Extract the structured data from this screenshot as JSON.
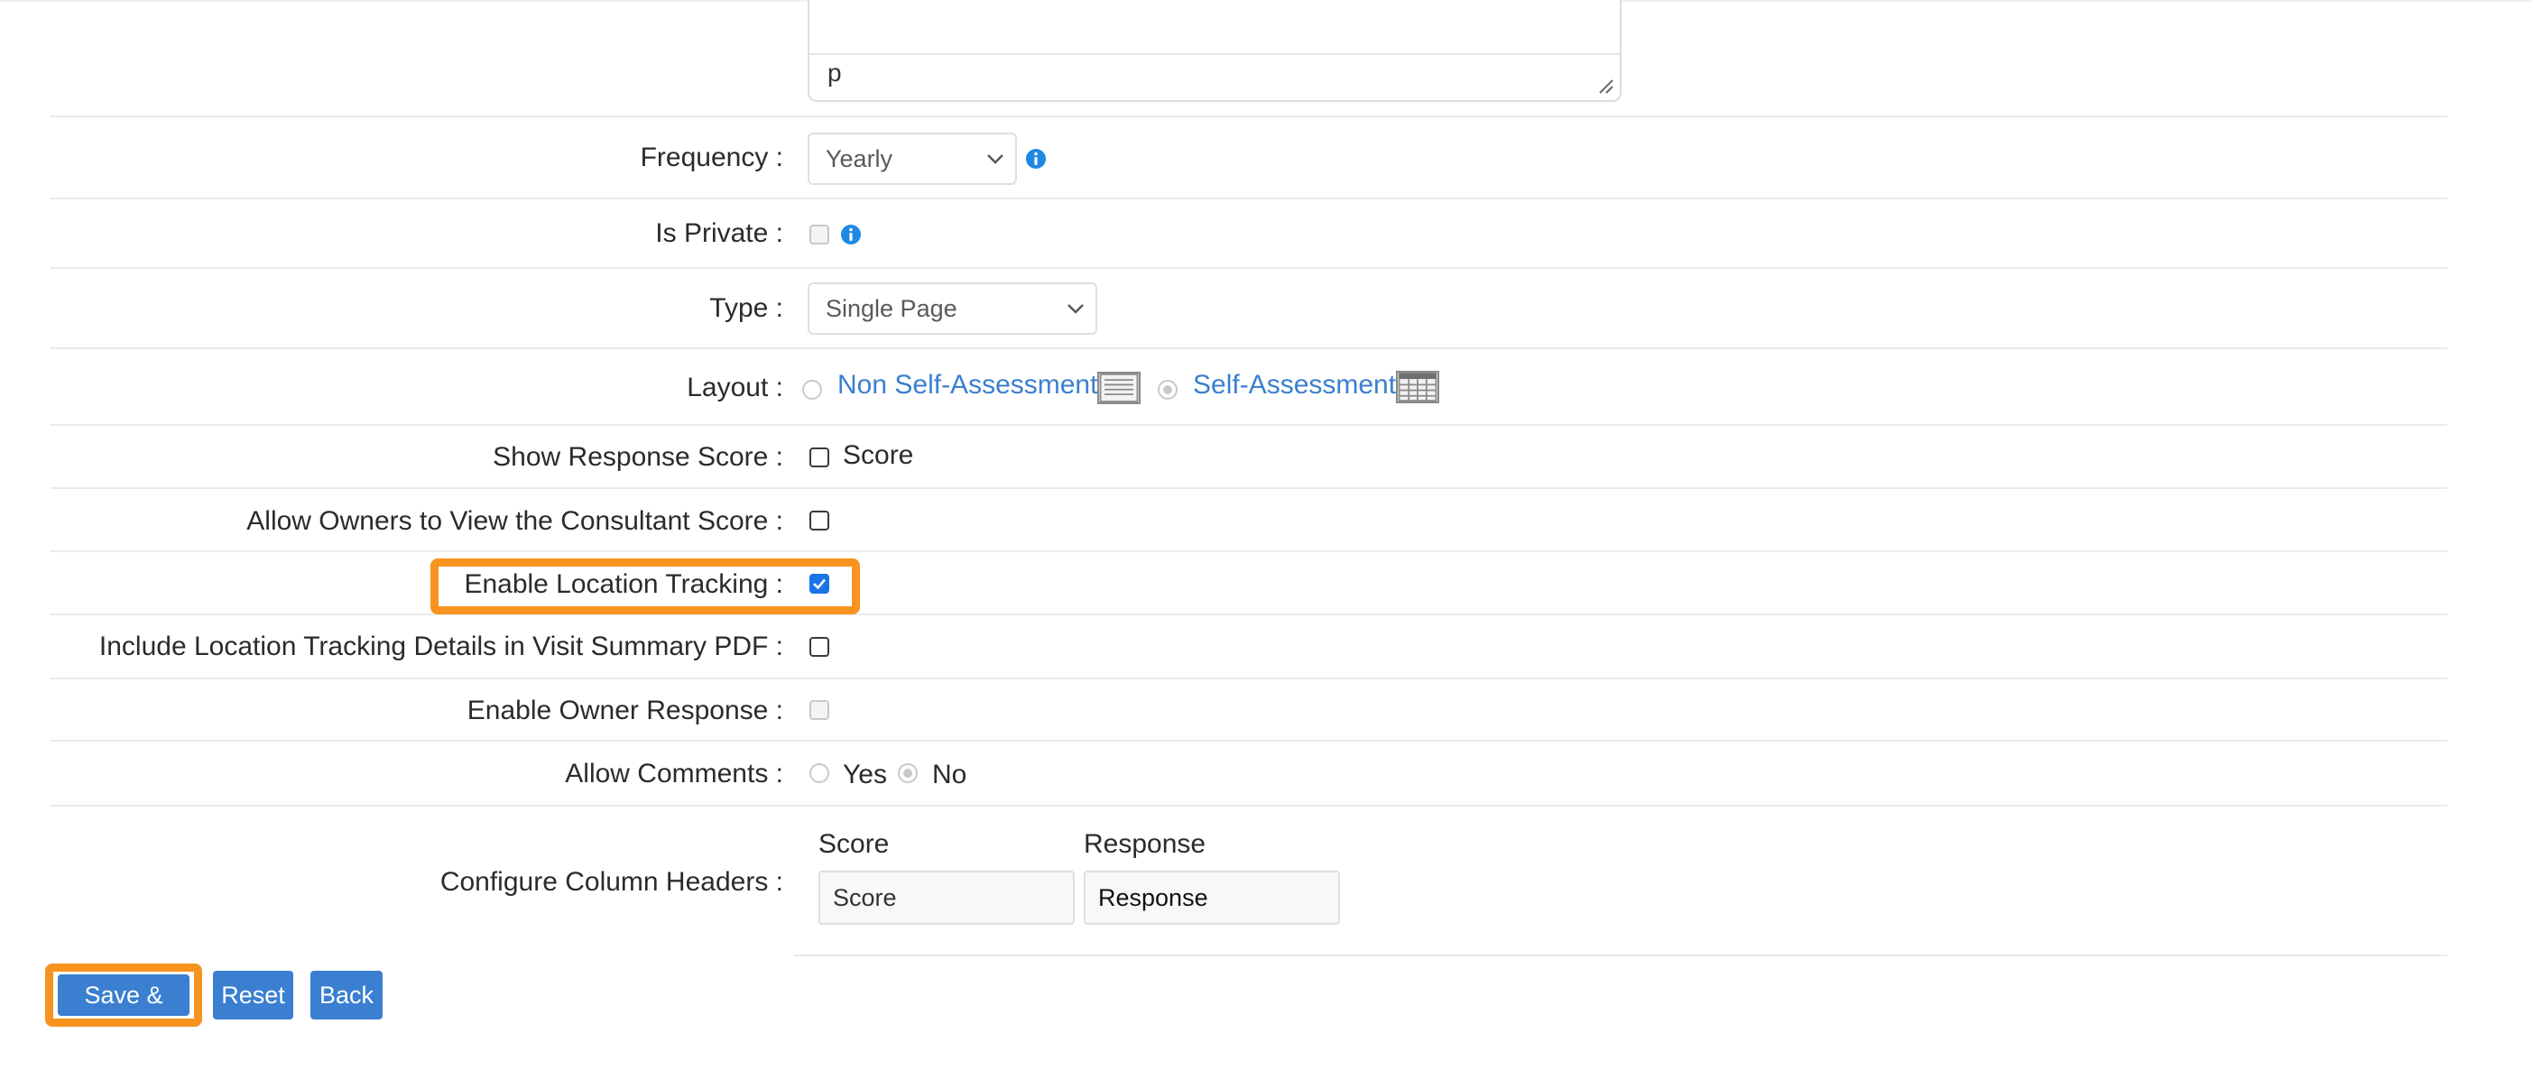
{
  "editor": {
    "status_path": "p"
  },
  "form": {
    "frequency": {
      "label": "Frequency :",
      "value": "Yearly",
      "info_icon": "info-icon"
    },
    "is_private": {
      "label": "Is Private :",
      "checked": false,
      "disabled": true,
      "info_icon": "info-icon"
    },
    "type": {
      "label": "Type :",
      "value": "Single Page"
    },
    "layout": {
      "label": "Layout :",
      "options": [
        {
          "label": "Non Self-Assessment",
          "selected": false,
          "icon": "list-layout-icon"
        },
        {
          "label": "Self-Assessment",
          "selected": true,
          "icon": "grid-layout-icon"
        }
      ]
    },
    "show_response_score": {
      "label": "Show Response Score :",
      "checkbox_label": "Score",
      "checked": false
    },
    "allow_owners_view_consultant_score": {
      "label": "Allow Owners to View the Consultant Score :",
      "checked": false
    },
    "enable_location_tracking": {
      "label": "Enable Location Tracking :",
      "checked": true
    },
    "include_location_tracking_pdf": {
      "label": "Include Location Tracking Details in Visit Summary PDF :",
      "checked": false
    },
    "enable_owner_response": {
      "label": "Enable Owner Response :",
      "checked": false,
      "disabled": true
    },
    "allow_comments": {
      "label": "Allow Comments :",
      "options": [
        {
          "label": "Yes",
          "selected": false
        },
        {
          "label": "No",
          "selected": true
        }
      ]
    },
    "column_headers": {
      "label": "Configure Column Headers :",
      "columns": [
        {
          "header": "Score",
          "value": "Score"
        },
        {
          "header": "Response",
          "value": "Response"
        }
      ]
    }
  },
  "buttons": {
    "save_next": "Save & Next",
    "reset": "Reset",
    "back": "Back"
  },
  "colors": {
    "accent": "#3a7fd0",
    "highlight": "#f7931e",
    "checkbox_checked": "#1a73e8",
    "info_icon": "#1e88e5"
  }
}
